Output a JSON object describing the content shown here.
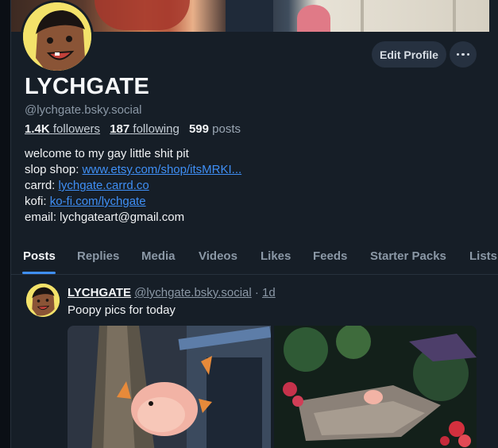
{
  "profile": {
    "display_name": "LYCHGATE",
    "handle": "@lychgate.bsky.social",
    "followers_count": "1.4K",
    "followers_label": "followers",
    "following_count": "187",
    "following_label": "following",
    "posts_count": "599",
    "posts_label": "posts",
    "edit_profile_label": "Edit Profile",
    "bio": {
      "line1": "welcome to my gay little shit pit",
      "slop_prefix": "slop shop: ",
      "slop_link": "www.etsy.com/shop/itsMRKI...",
      "carrd_prefix": "carrd: ",
      "carrd_link": "lychgate.carrd.co",
      "kofi_prefix": "kofi: ",
      "kofi_link": "ko-fi.com/lychgate",
      "email_line": "email: lychgateart@gmail.com"
    }
  },
  "tabs": [
    "Posts",
    "Replies",
    "Media",
    "Videos",
    "Likes",
    "Feeds",
    "Starter Packs",
    "Lists"
  ],
  "post": {
    "author_name": "LYCHGATE",
    "author_handle": "@lychgate.bsky.social",
    "separator": "·",
    "time": "1d",
    "text": "Poopy pics for today",
    "images": [
      "photo-plush-on-statue",
      "photo-plush-on-rock-garden"
    ]
  },
  "colors": {
    "background": "#161e27",
    "accent": "#3f8ff5",
    "muted_text": "#8b98a6"
  }
}
